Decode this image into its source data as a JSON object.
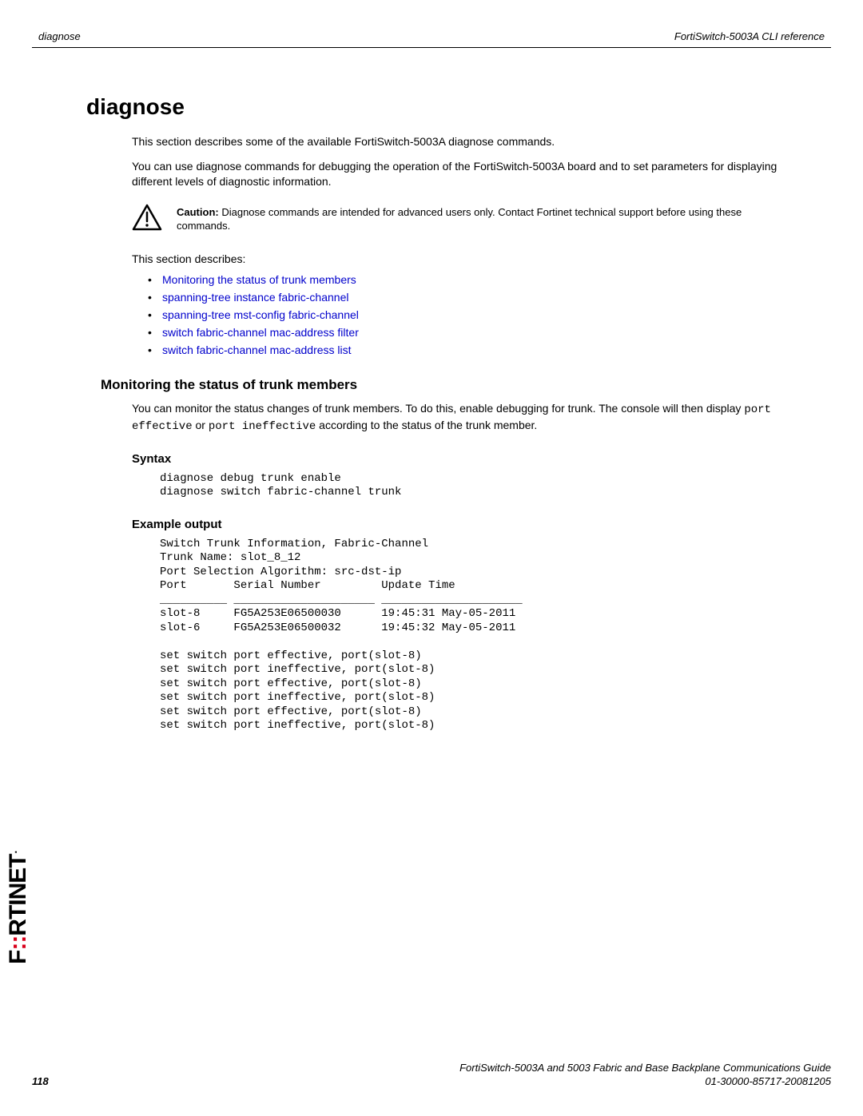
{
  "header": {
    "left": "diagnose",
    "right": "FortiSwitch-5003A CLI reference"
  },
  "main_heading": "diagnose",
  "intro_para1": "This section describes some of the available FortiSwitch-5003A diagnose commands.",
  "intro_para2": "You can use diagnose commands for debugging the operation of the FortiSwitch-5003A board and to set parameters for displaying different levels of diagnostic information.",
  "caution_label": "Caution:",
  "caution_text": " Diagnose commands are intended for advanced users only. Contact Fortinet technical support before using these commands.",
  "section_desc": "This section describes:",
  "links": [
    "Monitoring the status of trunk members",
    "spanning-tree instance fabric-channel",
    "spanning-tree mst-config fabric-channel",
    "switch fabric-channel mac-address filter",
    "switch fabric-channel mac-address list"
  ],
  "sub_heading": "Monitoring the status of trunk members",
  "monitor_para_pre": "You can monitor the status changes of trunk members. To do this, enable debugging for trunk. The console will then display ",
  "mono1": "port effective",
  "monitor_para_mid": " or ",
  "mono2": "port ineffective",
  "monitor_para_post": " according to the status of the trunk member.",
  "syntax_heading": "Syntax",
  "syntax_block": "diagnose debug trunk enable\ndiagnose switch fabric-channel trunk",
  "example_heading": "Example output",
  "example_block": "Switch Trunk Information, Fabric-Channel\nTrunk Name: slot_8_12\nPort Selection Algorithm: src-dst-ip\nPort       Serial Number         Update Time\n__________ _____________________ _____________________\nslot-8     FG5A253E06500030      19:45:31 May-05-2011\nslot-6     FG5A253E06500032      19:45:32 May-05-2011\n\nset switch port effective, port(slot-8)\nset switch port ineffective, port(slot-8)\nset switch port effective, port(slot-8)\nset switch port ineffective, port(slot-8)\nset switch port effective, port(slot-8)\nset switch port ineffective, port(slot-8)",
  "logo_black1": "F",
  "logo_red": "::",
  "logo_black2": "RTINET",
  "logo_dot": ".",
  "footer": {
    "line1": "FortiSwitch-5003A and 5003   Fabric and Base Backplane Communications Guide",
    "page": "118",
    "line2": "01-30000-85717-20081205"
  }
}
